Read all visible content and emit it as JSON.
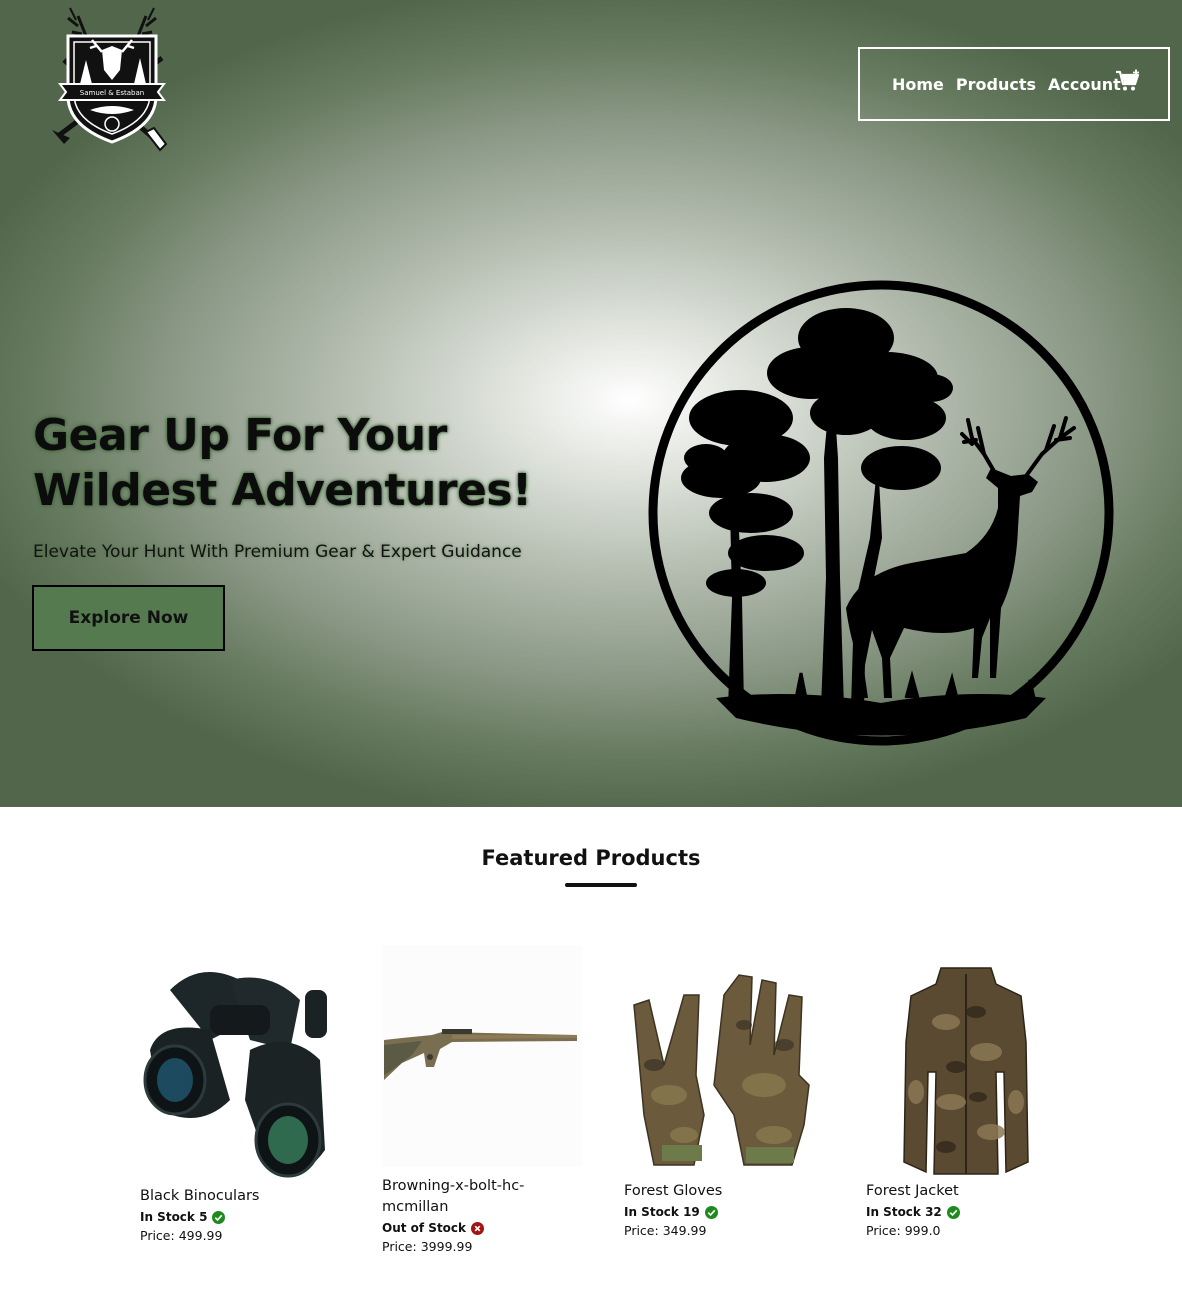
{
  "header": {
    "logo_text": "Samuel & Estaban",
    "nav": [
      {
        "label": "Home"
      },
      {
        "label": "Products"
      },
      {
        "label": "Account"
      }
    ],
    "cart_icon": "shopping-cart-plus-icon"
  },
  "hero": {
    "title": "Gear Up For Your Wildest Adventures!",
    "subtitle": "Elevate Your Hunt With Premium Gear & Expert Guidance",
    "cta_label": "Explore Now",
    "image": "deer-and-tree-silhouette-circle"
  },
  "featured": {
    "title": "Featured Products",
    "products": [
      {
        "name": "Black Binoculars",
        "stock_text": "In Stock 5",
        "in_stock": true,
        "price_label": "Price:",
        "price": "499.99",
        "image": "binoculars"
      },
      {
        "name": "Browning-x-bolt-hc-mcmillan",
        "stock_text": "Out of Stock",
        "in_stock": false,
        "price_label": "Price:",
        "price": "3999.99",
        "image": "rifle"
      },
      {
        "name": "Forest Gloves",
        "stock_text": "In Stock 19",
        "in_stock": true,
        "price_label": "Price:",
        "price": "349.99",
        "image": "camo-gloves"
      },
      {
        "name": "Forest Jacket",
        "stock_text": "In Stock 32",
        "in_stock": true,
        "price_label": "Price:",
        "price": "999.0",
        "image": "camo-jacket"
      }
    ]
  },
  "colors": {
    "hero_dark": "#52664b",
    "cta_bg": "#567a50",
    "in_stock": "#1e8a1e",
    "out_of_stock": "#a31515"
  }
}
